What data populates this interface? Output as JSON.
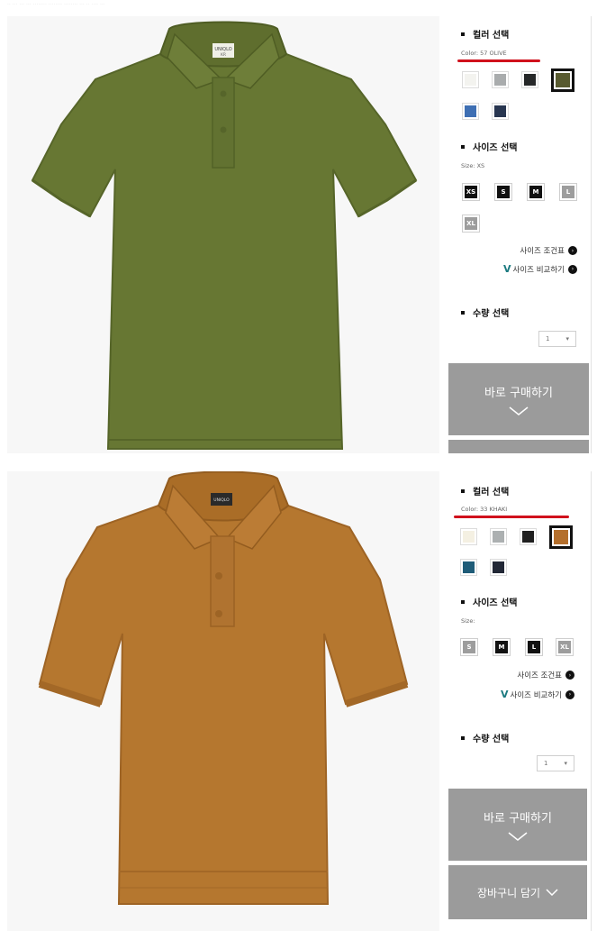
{
  "page": {
    "faint_top_text": "·· ··· ··· ··· ········ ········ ········ ··· ·· ···· ···"
  },
  "panels": [
    {
      "brand_tag": "UNIQLO",
      "tag_text": "KR",
      "color_heading": "컬러 선택",
      "color_value": "Color: 57 OLIVE",
      "swatches": [
        "#f3f3ef",
        "#a9acad",
        "#262829",
        "#585a2f",
        "#3e6fb3",
        "#283650"
      ],
      "selected_swatch": "#585a2f",
      "shirt_color": "#677733",
      "size_heading": "사이즈 선택",
      "size_value": "Size: XS",
      "sizes": [
        "XS",
        "S",
        "M",
        "L",
        "XL"
      ],
      "size_available": [
        true,
        true,
        true,
        false,
        false
      ],
      "size_chart": "사이즈 조건표",
      "size_compare": "사이즈 비교하기",
      "qty_heading": "수량 선택",
      "qty_value": "1",
      "buy_label": "바로 구매하기"
    },
    {
      "brand_tag": "UNIQLO",
      "color_heading": "컬러 선택",
      "color_value": "Color: 33 KHAKI",
      "swatches": [
        "#f4f0e2",
        "#acb0b1",
        "#1f1f1f",
        "#b46f2c",
        "#1f5c78",
        "#222836"
      ],
      "selected_swatch": "#b46f2c",
      "shirt_color": "#b5772f",
      "size_heading": "사이즈 선택",
      "size_value": "Size:",
      "sizes": [
        "S",
        "M",
        "L",
        "XL"
      ],
      "size_available": [
        false,
        true,
        true,
        false
      ],
      "size_chart": "사이즈 조건표",
      "size_compare": "사이즈 비교하기",
      "qty_heading": "수량 선택",
      "qty_value": "1",
      "buy_label": "바로 구매하기",
      "cart_label": "장바구니 담기"
    }
  ]
}
